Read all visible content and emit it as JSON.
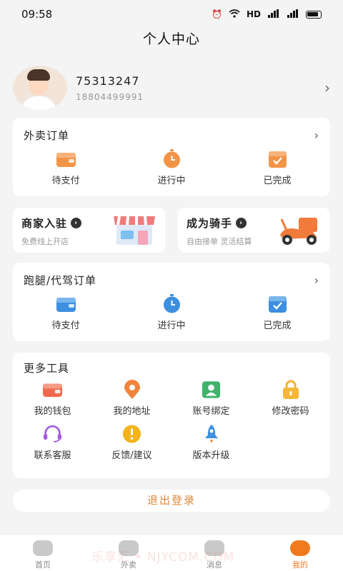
{
  "status_bar": {
    "time": "09:58",
    "hd": "HD"
  },
  "page_title": "个人中心",
  "profile": {
    "name": "75313247",
    "phone": "18804499991"
  },
  "takeout_orders": {
    "title": "外卖订单",
    "items": [
      {
        "label": "待支付",
        "icon": "wallet-icon"
      },
      {
        "label": "进行中",
        "icon": "timer-icon"
      },
      {
        "label": "已完成",
        "icon": "check-box-icon"
      }
    ]
  },
  "promos": [
    {
      "title": "商家入驻",
      "subtitle": "免费线上开店",
      "icon": "storefront-icon"
    },
    {
      "title": "成为骑手",
      "subtitle": "自由接单 灵活结算",
      "icon": "scooter-icon"
    }
  ],
  "errand_orders": {
    "title": "跑腿/代驾订单",
    "items": [
      {
        "label": "待支付",
        "icon": "wallet-icon"
      },
      {
        "label": "进行中",
        "icon": "timer-icon"
      },
      {
        "label": "已完成",
        "icon": "check-box-icon"
      }
    ]
  },
  "more_tools": {
    "title": "更多工具",
    "items": [
      {
        "label": "我的钱包",
        "icon": "wallet-icon"
      },
      {
        "label": "我的地址",
        "icon": "location-icon"
      },
      {
        "label": "账号绑定",
        "icon": "account-icon"
      },
      {
        "label": "修改密码",
        "icon": "lock-icon"
      },
      {
        "label": "联系客服",
        "icon": "headset-icon"
      },
      {
        "label": "反馈/建议",
        "icon": "feedback-icon"
      },
      {
        "label": "版本升级",
        "icon": "rocket-icon"
      }
    ]
  },
  "logout_label": "退出登录",
  "tabbar": [
    {
      "label": "首页",
      "icon": "home-icon",
      "active": false
    },
    {
      "label": "外卖",
      "icon": "takeout-icon",
      "active": false
    },
    {
      "label": "消息",
      "icon": "message-icon",
      "active": false
    },
    {
      "label": "我的",
      "icon": "profile-icon",
      "active": true
    }
  ],
  "watermark": "乐享汇 • NJYCOM.COM",
  "colors": {
    "accent": "#f07b1f",
    "orange_icon": "#f29447",
    "blue_icon": "#3d8fe0",
    "logout_text": "#e0883a"
  }
}
